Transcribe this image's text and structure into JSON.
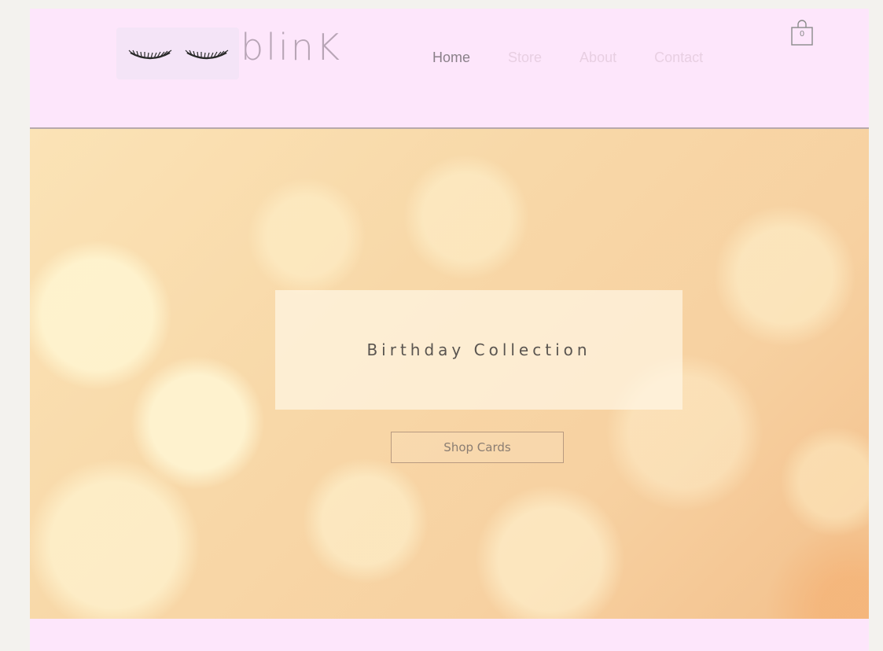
{
  "brand": {
    "logo_text": "blinK",
    "colors": {
      "header_bg": "#fde6fb",
      "logo_text": "#b8a5b6",
      "nav_active": "#8a8089",
      "nav_inactive": "#e8cfe2",
      "hero_base": "#f8d8a8"
    }
  },
  "nav": {
    "items": [
      {
        "label": "Home",
        "active": true
      },
      {
        "label": "Store",
        "active": false
      },
      {
        "label": "About",
        "active": false
      },
      {
        "label": "Contact",
        "active": false
      }
    ]
  },
  "cart": {
    "icon": "shopping-bag-icon",
    "count": "0"
  },
  "hero": {
    "title": "Birthday Collection",
    "cta_label": "Shop Cards"
  }
}
